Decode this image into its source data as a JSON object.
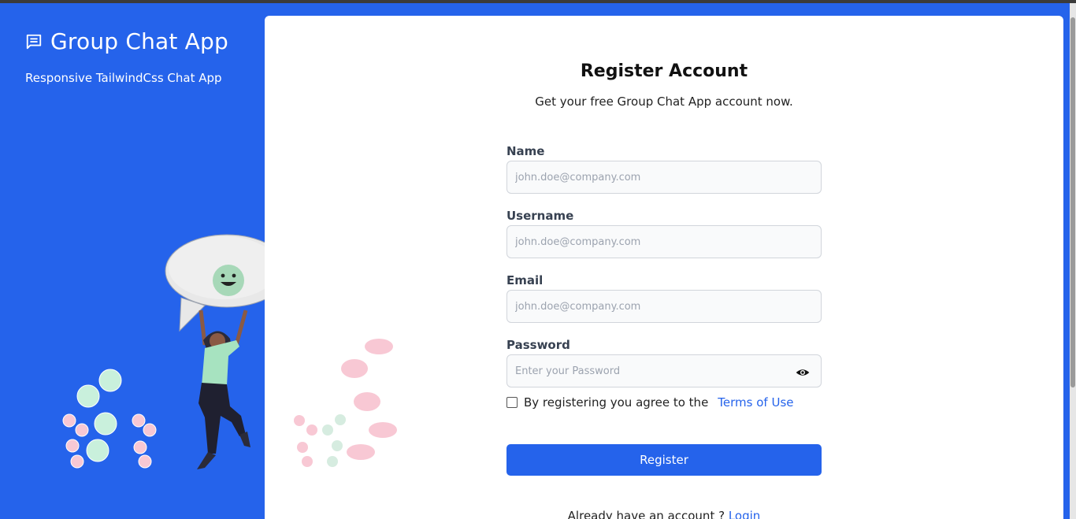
{
  "brand": {
    "title": "Group Chat App",
    "subtitle": "Responsive TailwindCss Chat App",
    "icon": "chat-message-icon"
  },
  "form": {
    "title": "Register Account",
    "subtitle": "Get your free Group Chat App account now.",
    "fields": [
      {
        "label": "Name",
        "placeholder": "john.doe@company.com",
        "value": ""
      },
      {
        "label": "Username",
        "placeholder": "john.doe@company.com",
        "value": ""
      },
      {
        "label": "Email",
        "placeholder": "john.doe@company.com",
        "value": ""
      },
      {
        "label": "Password",
        "placeholder": "Enter your Password",
        "value": ""
      }
    ],
    "terms_text": "By registering you agree to the",
    "terms_link": "Terms of Use",
    "terms_checked": false,
    "submit_label": "Register",
    "login_prompt": "Already have an account ?",
    "login_link": "Login"
  },
  "colors": {
    "primary": "#2563eb",
    "card": "#ffffff"
  }
}
